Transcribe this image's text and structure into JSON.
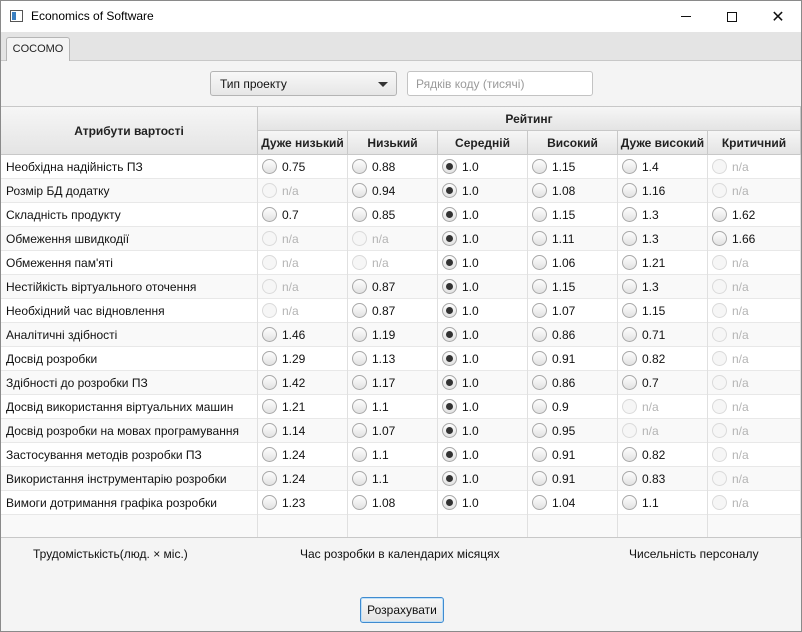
{
  "window": {
    "title": "Economics of Software"
  },
  "tabs": [
    {
      "label": "COCOMO"
    }
  ],
  "controls": {
    "project_type_label": "Тип проекту",
    "loc_placeholder": "Рядків коду (тисячі)"
  },
  "table": {
    "attr_header": "Атрибути вартості",
    "rating_header": "Рейтинг",
    "columns": [
      "Дуже низький",
      "Низький",
      "Середній",
      "Високий",
      "Дуже високий",
      "Критичний"
    ],
    "rows": [
      {
        "label": "Необхідна надійність ПЗ",
        "values": [
          "0.75",
          "0.88",
          "1.0",
          "1.15",
          "1.4",
          "n/a"
        ]
      },
      {
        "label": "Розмір БД додатку",
        "values": [
          "n/a",
          "0.94",
          "1.0",
          "1.08",
          "1.16",
          "n/a"
        ]
      },
      {
        "label": "Складність продукту",
        "values": [
          "0.7",
          "0.85",
          "1.0",
          "1.15",
          "1.3",
          "1.62"
        ]
      },
      {
        "label": "Обмеження швидкодії",
        "values": [
          "n/a",
          "n/a",
          "1.0",
          "1.11",
          "1.3",
          "1.66"
        ]
      },
      {
        "label": "Обмеження пам'яті",
        "values": [
          "n/a",
          "n/a",
          "1.0",
          "1.06",
          "1.21",
          "n/a"
        ]
      },
      {
        "label": "Нестійкість віртуального оточення",
        "values": [
          "n/a",
          "0.87",
          "1.0",
          "1.15",
          "1.3",
          "n/a"
        ]
      },
      {
        "label": "Необхідний час відновлення",
        "values": [
          "n/a",
          "0.87",
          "1.0",
          "1.07",
          "1.15",
          "n/a"
        ]
      },
      {
        "label": "Аналітичні здібності",
        "values": [
          "1.46",
          "1.19",
          "1.0",
          "0.86",
          "0.71",
          "n/a"
        ]
      },
      {
        "label": "Досвід розробки",
        "values": [
          "1.29",
          "1.13",
          "1.0",
          "0.91",
          "0.82",
          "n/a"
        ]
      },
      {
        "label": "Здібності до розробки ПЗ",
        "values": [
          "1.42",
          "1.17",
          "1.0",
          "0.86",
          "0.7",
          "n/a"
        ]
      },
      {
        "label": "Досвід використання віртуальних машин",
        "values": [
          "1.21",
          "1.1",
          "1.0",
          "0.9",
          "n/a",
          "n/a"
        ]
      },
      {
        "label": "Досвід розробки на мовах програмування",
        "values": [
          "1.14",
          "1.07",
          "1.0",
          "0.95",
          "n/a",
          "n/a"
        ]
      },
      {
        "label": "Застосування методів розробки ПЗ",
        "values": [
          "1.24",
          "1.1",
          "1.0",
          "0.91",
          "0.82",
          "n/a"
        ]
      },
      {
        "label": "Використання інструментарію розробки",
        "values": [
          "1.24",
          "1.1",
          "1.0",
          "0.91",
          "0.83",
          "n/a"
        ]
      },
      {
        "label": "Вимоги дотримання графіка розробки",
        "values": [
          "1.23",
          "1.08",
          "1.0",
          "1.04",
          "1.1",
          "n/a"
        ]
      }
    ],
    "selected_column": 2
  },
  "footer": {
    "effort_label": "Трудомістькість(люд. × міс.)",
    "schedule_label": "Час розробки в календарих місяцях",
    "staff_label": "Чисельність персоналу",
    "calculate_label": "Розрахувати"
  }
}
